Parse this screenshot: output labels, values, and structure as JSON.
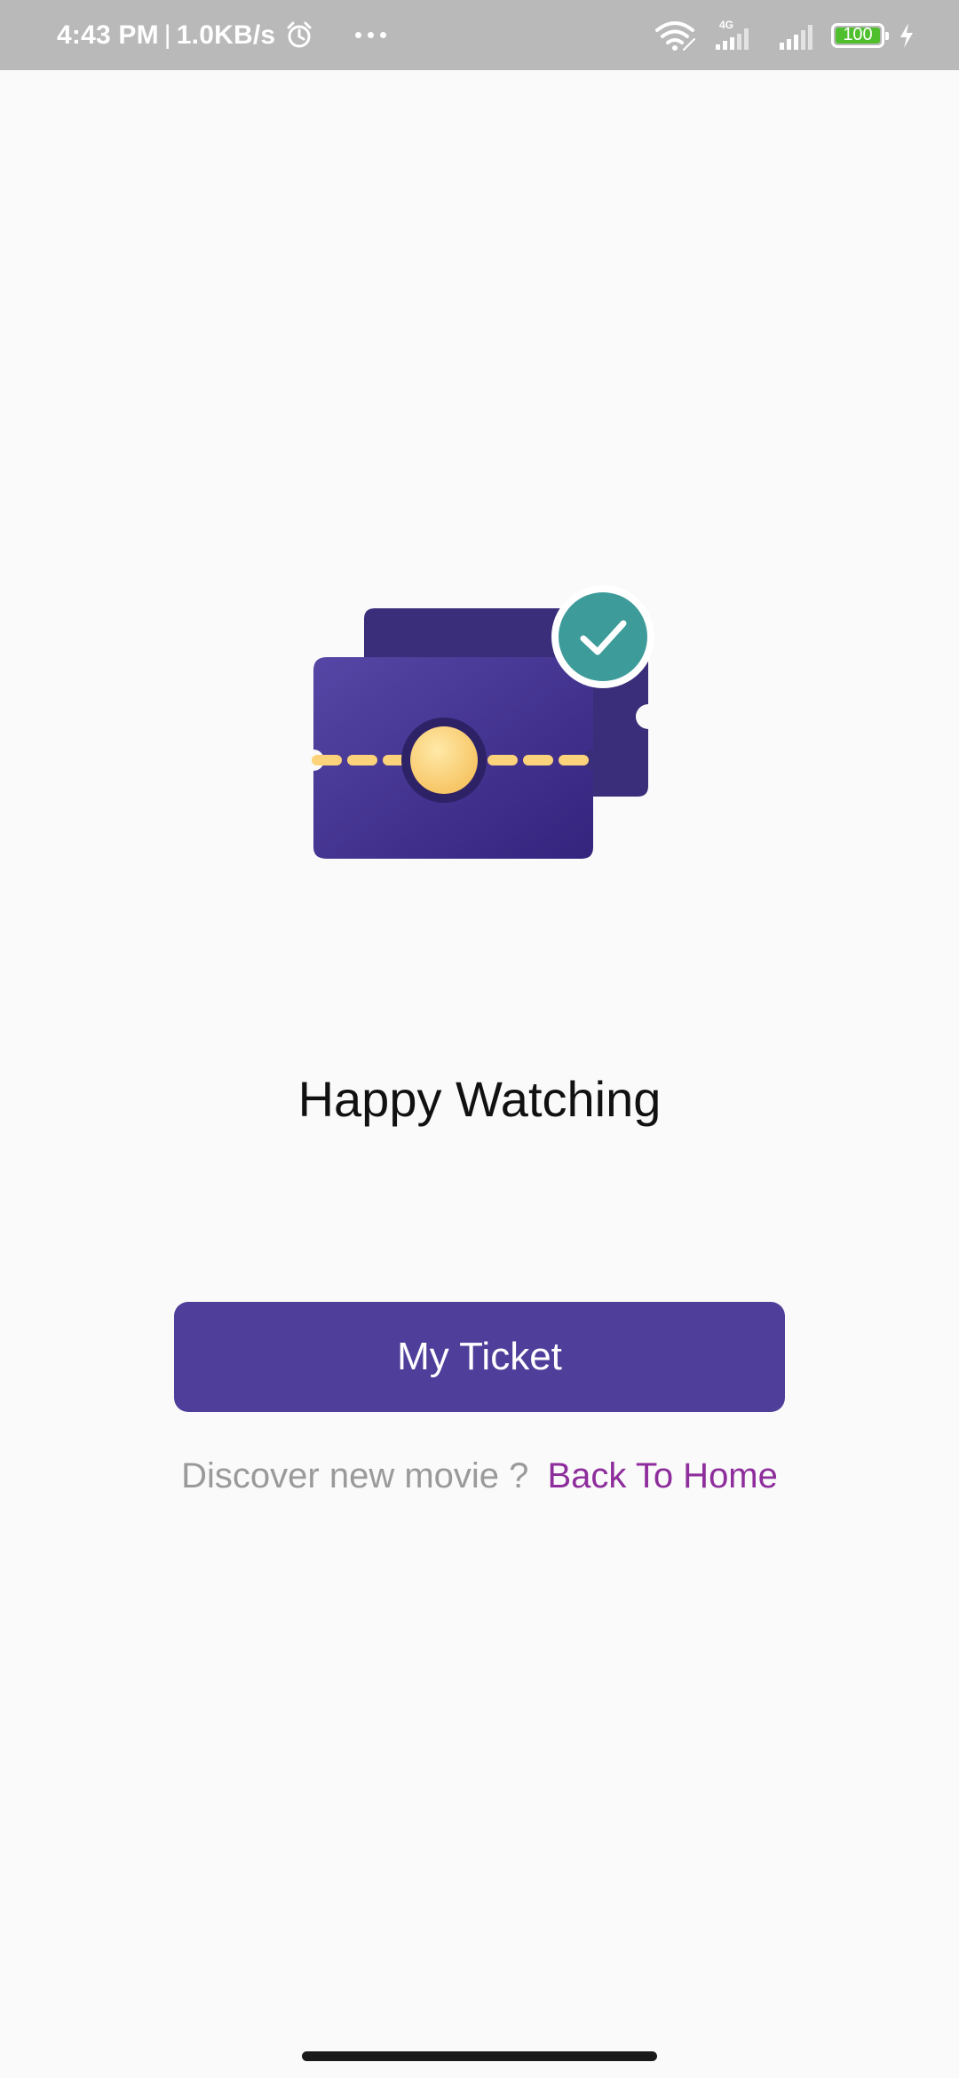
{
  "status_bar": {
    "time": "4:43 PM",
    "separator": "|",
    "network_speed": "1.0KB/s",
    "network_type": "4G",
    "battery_level": "100",
    "icons": [
      "alarm-icon",
      "more-icon",
      "wifi-icon",
      "signal-icon",
      "battery-icon",
      "charging-icon"
    ]
  },
  "illustration": {
    "icons": [
      "ticket-icon",
      "check-badge-icon"
    ],
    "colors": {
      "ticket_front": "#4f3f9b",
      "ticket_back": "#3a2d79",
      "dash_and_circle": "#fcd27a",
      "check_badge": "#3d9b9a"
    }
  },
  "main": {
    "headline": "Happy Watching",
    "primary_button_label": "My Ticket",
    "footer_prompt": "Discover new movie ?",
    "footer_link": "Back To Home"
  },
  "colors": {
    "accent": "#4f3f9b",
    "link": "#8e2d9c",
    "background": "#fafafa",
    "status_bar": "#b9b9b9"
  }
}
